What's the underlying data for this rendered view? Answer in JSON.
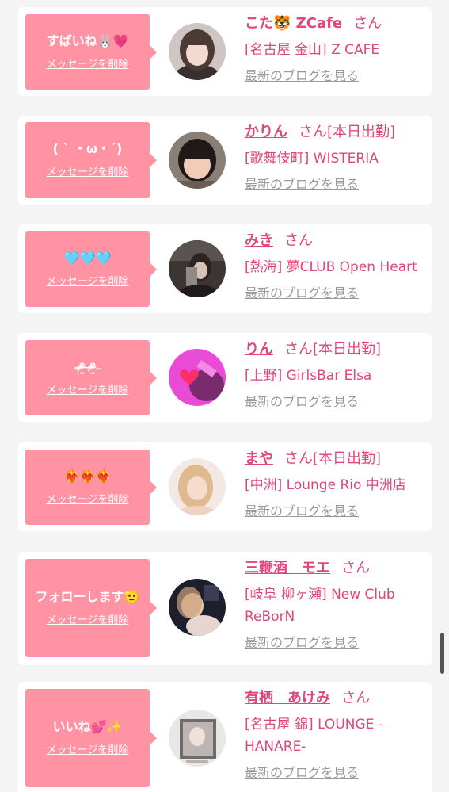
{
  "cards": [
    {
      "message": "すぱいね🐰💗",
      "delete_label": "メッセージを削除",
      "name": "こた🐯 ZCafe",
      "honorific": "さん",
      "status": "",
      "shop": "[名古屋 金山] Z CAFE",
      "blog_link": "最新のブログを見る"
    },
    {
      "message": "( ˋ ・ω・ˊ)",
      "delete_label": "メッセージを削除",
      "name": "かりん",
      "honorific": "さん",
      "status": "[本日出勤]",
      "shop": "[歌舞伎町] WISTERIA",
      "blog_link": "最新のブログを見る"
    },
    {
      "message": "🩵🩵🩵",
      "delete_label": "メッセージを削除",
      "name": "みき",
      "honorific": "さん",
      "status": "",
      "shop": "[熱海] 夢CLUB Open Heart",
      "blog_link": "最新のブログを見る"
    },
    {
      "message": "˶ᵒ̴̶̷̤ ᵒ̴̶̷̤˶",
      "delete_label": "メッセージを削除",
      "name": "りん",
      "honorific": "さん",
      "status": "[本日出勤]",
      "shop": "[上野] GirlsBar Elsa",
      "blog_link": "最新のブログを見る"
    },
    {
      "message": "❤️‍🔥❤️‍🔥❤️‍🔥",
      "delete_label": "メッセージを削除",
      "name": "まや",
      "honorific": "さん",
      "status": "[本日出勤]",
      "shop": "[中洲] Lounge Rio 中洲店",
      "blog_link": "最新のブログを見る"
    },
    {
      "message": "フォローします🫡",
      "delete_label": "メッセージを削除",
      "name": "三鞭酒　モエ",
      "honorific": "さん",
      "status": "",
      "shop": "[岐阜 柳ヶ瀬] New Club ReBorN",
      "blog_link": "最新のブログを見る"
    },
    {
      "message": "いいね💕✨",
      "delete_label": "メッセージを削除",
      "name": "有栖　あけみ",
      "honorific": "さん",
      "status": "",
      "shop": "[名古屋 錦] LOUNGE - HANARE-",
      "blog_link": "最新のブログを見る"
    }
  ],
  "colors": {
    "bubble": "#ff93a3",
    "accent_text": "#e0457b",
    "link_gray": "#9a9a9a",
    "card_bg": "#ffffff",
    "page_bg": "#f4f4f4"
  }
}
